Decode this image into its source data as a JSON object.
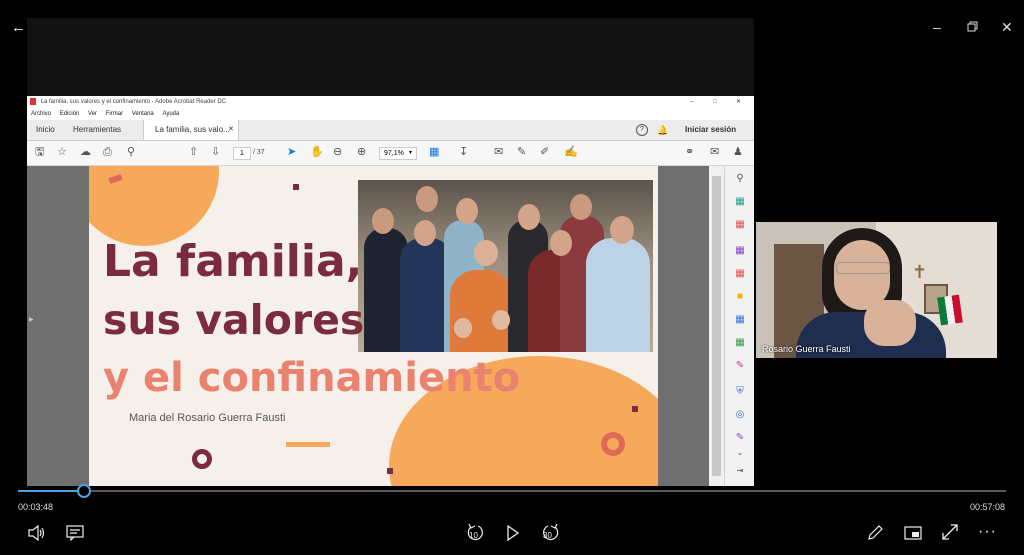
{
  "player": {
    "current_time": "00:03:48",
    "total_time": "00:57:08",
    "progress": 0.0665,
    "skip_back_label": "10",
    "skip_forward_label": "30"
  },
  "acrobat": {
    "window_title": "La familia,  sus valores y el confinamiento - Adobe Acrobat Reader DC",
    "menu": [
      "Archivo",
      "Edición",
      "Ver",
      "Firmar",
      "Ventana",
      "Ayuda"
    ],
    "tabs": [
      "Inicio",
      "Herramientas",
      "La familia,  sus valo..."
    ],
    "sign_in": "Iniciar sesión",
    "page_current": "1",
    "page_total": "/ 37",
    "zoom": "97,1%"
  },
  "slide": {
    "title_line1": "La familia,",
    "title_line2": "sus valores",
    "title_line3": "y el confinamiento",
    "author": "Maria del Rosario Guerra Fausti"
  },
  "webcam": {
    "participant_name": "Rosario Guerra Fausti"
  },
  "colors": {
    "title_dark": "#7a2c3e",
    "title_accent": "#e9826e",
    "slide_orange": "#f6a95a",
    "progress": "#4fa3e0"
  }
}
